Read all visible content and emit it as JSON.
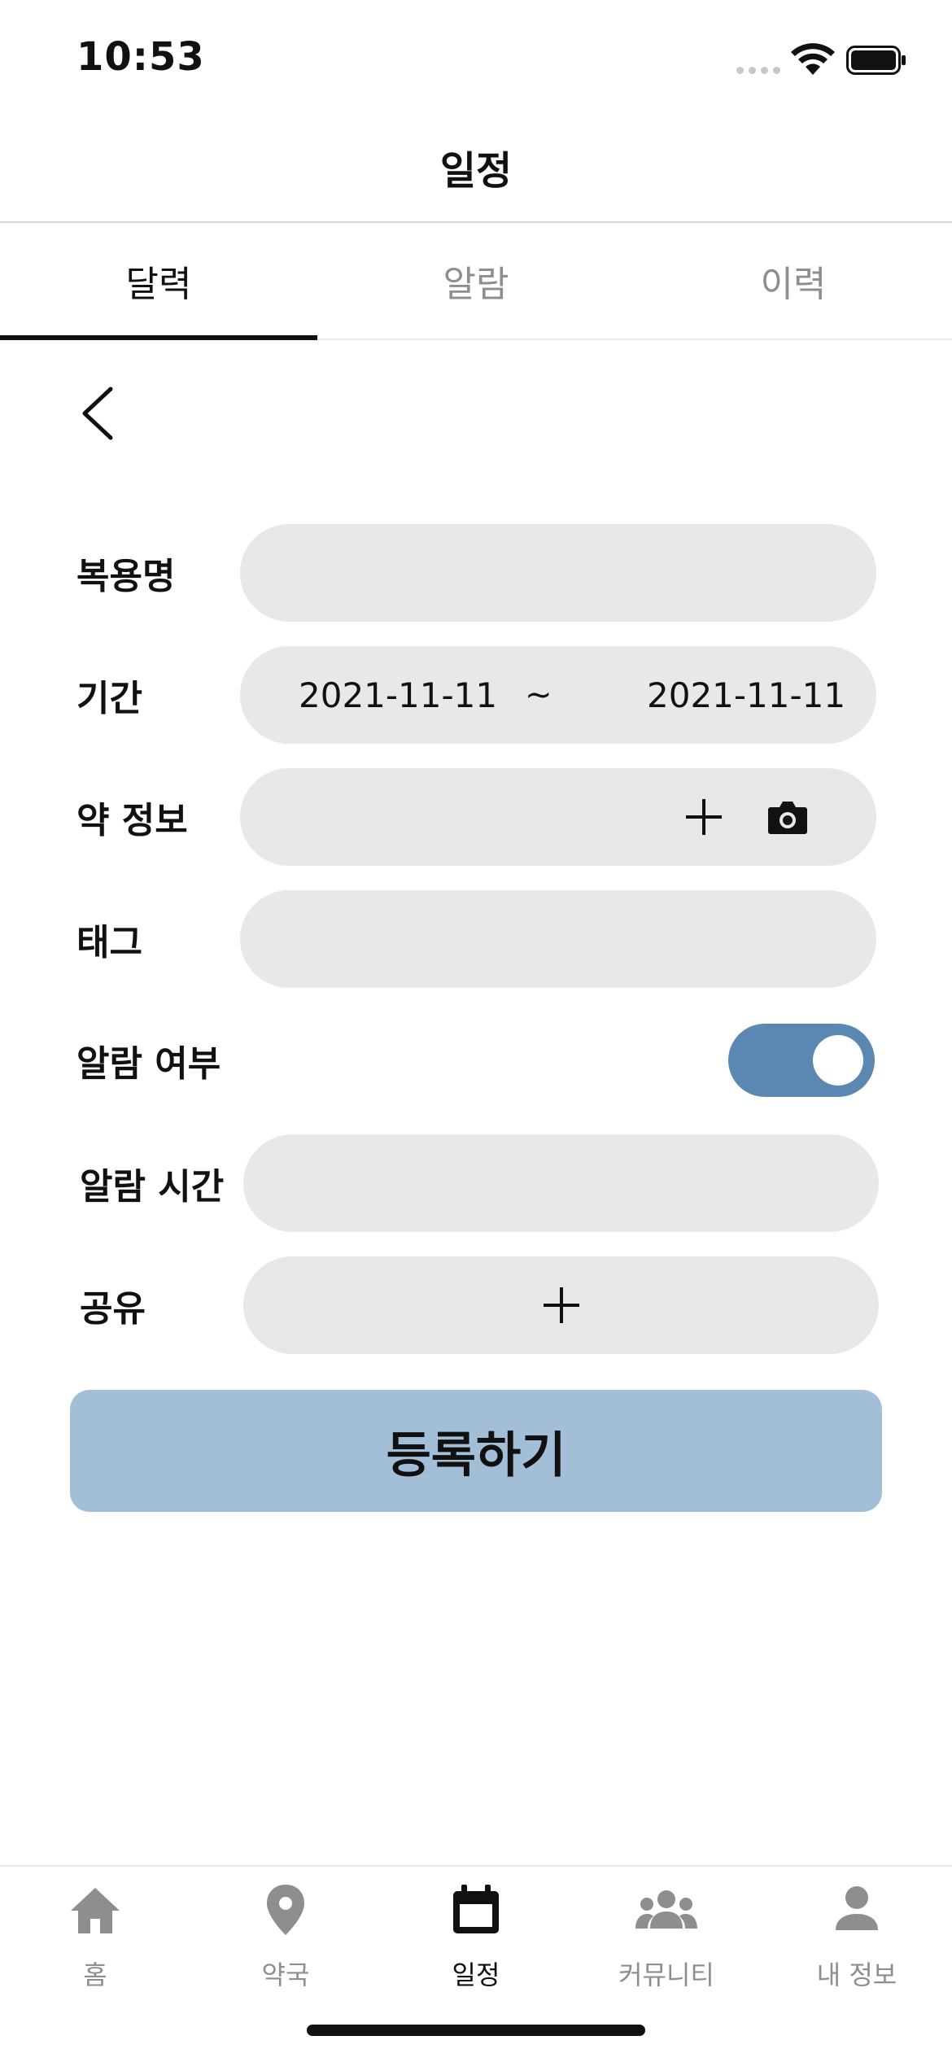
{
  "status_bar": {
    "time": "10:53"
  },
  "header": {
    "title": "일정"
  },
  "tabs": [
    {
      "label": "달력",
      "active": true
    },
    {
      "label": "알람",
      "active": false
    },
    {
      "label": "이력",
      "active": false
    }
  ],
  "form": {
    "medication_name": {
      "label": "복용명",
      "value": ""
    },
    "period": {
      "label": "기간",
      "start": "2021-11-11",
      "separator": "~",
      "end": "2021-11-11"
    },
    "drug_info": {
      "label": "약 정보",
      "value": ""
    },
    "tag": {
      "label": "태그",
      "value": ""
    },
    "alarm_enabled": {
      "label": "알람 여부",
      "on": true
    },
    "alarm_time": {
      "label": "알람 시간",
      "value": ""
    },
    "share": {
      "label": "공유"
    },
    "submit_label": "등록하기"
  },
  "colors": {
    "toggle_on": "#5b88b2",
    "submit_bg": "#a3bfd8",
    "field_bg": "#e8e8e8",
    "inactive": "#8e8e8e"
  },
  "bottom_nav": [
    {
      "label": "홈",
      "icon": "home-icon",
      "active": false
    },
    {
      "label": "약국",
      "icon": "location-pin-icon",
      "active": false
    },
    {
      "label": "일정",
      "icon": "calendar-icon",
      "active": true
    },
    {
      "label": "커뮤니티",
      "icon": "group-icon",
      "active": false
    },
    {
      "label": "내 정보",
      "icon": "person-icon",
      "active": false
    }
  ]
}
